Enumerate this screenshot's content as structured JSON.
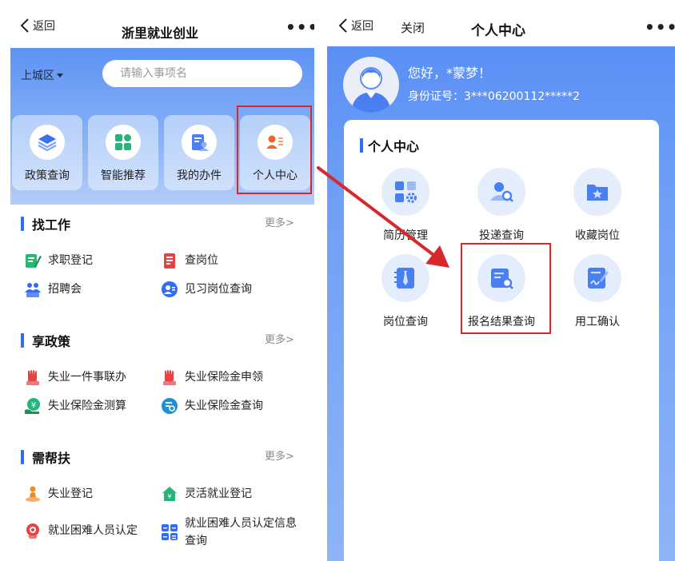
{
  "left": {
    "nav": {
      "back_label": "返回",
      "title": "浙里就业创业",
      "more": "•••"
    },
    "district": "上城区",
    "search_placeholder": "请输入事项名",
    "quick": [
      {
        "label": "政策查询",
        "icon": "layers-icon"
      },
      {
        "label": "智能推荐",
        "icon": "apps-icon"
      },
      {
        "label": "我的办件",
        "icon": "document-user-icon"
      },
      {
        "label": "个人中心",
        "icon": "user-card-icon"
      }
    ],
    "sections": [
      {
        "title": "找工作",
        "more": "更多>",
        "items": [
          {
            "label": "求职登记",
            "icon": "register-icon"
          },
          {
            "label": "查岗位",
            "icon": "job-list-icon"
          },
          {
            "label": "招聘会",
            "icon": "job-fair-icon"
          },
          {
            "label": "见习岗位查询",
            "icon": "intern-icon"
          }
        ]
      },
      {
        "title": "享政策",
        "more": "更多>",
        "items": [
          {
            "label": "失业一件事联办",
            "icon": "hand-icon"
          },
          {
            "label": "失业保险金申领",
            "icon": "hand-icon"
          },
          {
            "label": "失业保险金测算",
            "icon": "calc-money-icon"
          },
          {
            "label": "失业保险金查询",
            "icon": "search-doc-icon"
          }
        ]
      },
      {
        "title": "需帮扶",
        "more": "更多>",
        "items": [
          {
            "label": "失业登记",
            "icon": "person-pin-icon"
          },
          {
            "label": "灵活就业登记",
            "icon": "house-money-icon"
          },
          {
            "label": "就业困难人员认定",
            "icon": "badge-icon"
          },
          {
            "label": "就业困难人员认定信息查询",
            "icon": "calculator-icon"
          }
        ]
      }
    ]
  },
  "right": {
    "nav": {
      "back_label": "返回",
      "close_label": "关闭",
      "title": "个人中心",
      "more": "•••"
    },
    "greeting": "您好，*蒙梦！",
    "id_label": "身份证号：3***06200112*****2",
    "card_title": "个人中心",
    "grid": [
      {
        "label": "简历管理",
        "icon": "resume-settings-icon"
      },
      {
        "label": "投递查询",
        "icon": "user-search-icon"
      },
      {
        "label": "收藏岗位",
        "icon": "folder-star-icon"
      },
      {
        "label": "岗位查询",
        "icon": "job-tie-icon"
      },
      {
        "label": "报名结果查询",
        "icon": "doc-search-icon"
      },
      {
        "label": "用工确认",
        "icon": "sign-doc-icon"
      }
    ]
  },
  "colors": {
    "accent": "#2f6df6",
    "highlight": "#d9272e",
    "hero": "#5e93f5"
  }
}
